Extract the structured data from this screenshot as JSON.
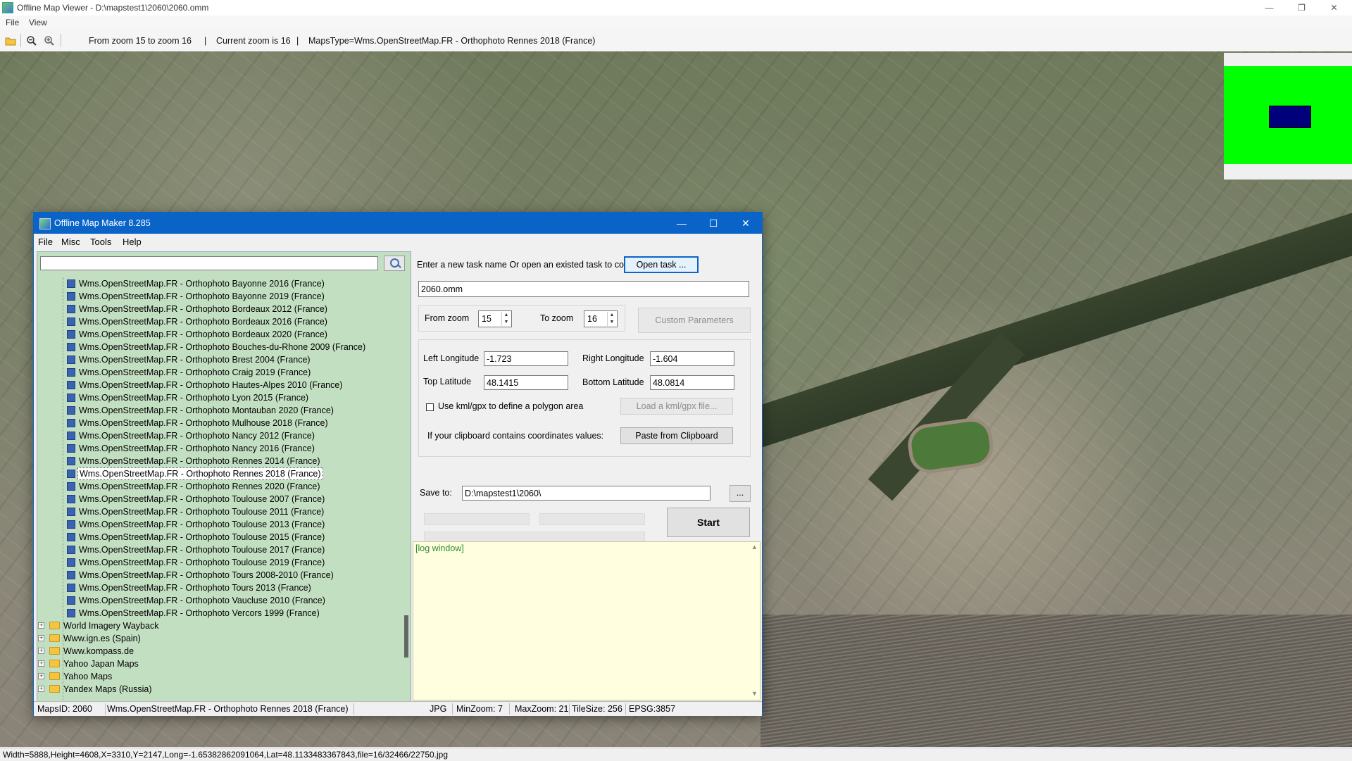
{
  "viewer": {
    "title": "Offline Map Viewer - D:\\mapstest1\\2060\\2060.omm",
    "menu": [
      "File",
      "View"
    ],
    "controls": {
      "minimize": "—",
      "maximize": "❐",
      "close": "✕"
    },
    "toolbar": {
      "zoom_range": "From zoom 15 to zoom 16",
      "sep": "|",
      "current_zoom": "Current zoom is 16",
      "maps_type": "MapsType=Wms.OpenStreetMap.FR - Orthophoto Rennes 2018 (France)"
    },
    "status": "Width=5888,Height=4608,X=3310,Y=2147,Long=-1.65382862091064,Lat=48.1133483367843,file=16/32466/22750.jpg"
  },
  "dialog": {
    "title": "Offline Map Maker 8.285",
    "controls": {
      "minimize": "—",
      "maximize": "☐",
      "close": "✕"
    },
    "menu": [
      "File",
      "Misc",
      "Tools",
      "Help"
    ],
    "search": {
      "value": "",
      "placeholder": ""
    },
    "tree": {
      "leaves": [
        "Wms.OpenStreetMap.FR - Orthophoto Bayonne 2016 (France)",
        "Wms.OpenStreetMap.FR - Orthophoto Bayonne 2019 (France)",
        "Wms.OpenStreetMap.FR - Orthophoto Bordeaux 2012 (France)",
        "Wms.OpenStreetMap.FR - Orthophoto Bordeaux 2016 (France)",
        "Wms.OpenStreetMap.FR - Orthophoto Bordeaux 2020 (France)",
        "Wms.OpenStreetMap.FR - Orthophoto Bouches-du-Rhone 2009 (France)",
        "Wms.OpenStreetMap.FR - Orthophoto Brest 2004 (France)",
        "Wms.OpenStreetMap.FR - Orthophoto Craig 2019 (France)",
        "Wms.OpenStreetMap.FR - Orthophoto Hautes-Alpes 2010 (France)",
        "Wms.OpenStreetMap.FR - Orthophoto Lyon 2015 (France)",
        "Wms.OpenStreetMap.FR - Orthophoto Montauban 2020 (France)",
        "Wms.OpenStreetMap.FR - Orthophoto Mulhouse 2018 (France)",
        "Wms.OpenStreetMap.FR - Orthophoto Nancy 2012 (France)",
        "Wms.OpenStreetMap.FR - Orthophoto Nancy 2016 (France)",
        "Wms.OpenStreetMap.FR - Orthophoto Rennes 2014 (France)",
        "Wms.OpenStreetMap.FR - Orthophoto Rennes 2018 (France)",
        "Wms.OpenStreetMap.FR - Orthophoto Rennes 2020 (France)",
        "Wms.OpenStreetMap.FR - Orthophoto Toulouse 2007 (France)",
        "Wms.OpenStreetMap.FR - Orthophoto Toulouse 2011 (France)",
        "Wms.OpenStreetMap.FR - Orthophoto Toulouse 2013 (France)",
        "Wms.OpenStreetMap.FR - Orthophoto Toulouse 2015 (France)",
        "Wms.OpenStreetMap.FR - Orthophoto Toulouse 2017 (France)",
        "Wms.OpenStreetMap.FR - Orthophoto Toulouse 2019 (France)",
        "Wms.OpenStreetMap.FR - Orthophoto Tours 2008-2010 (France)",
        "Wms.OpenStreetMap.FR - Orthophoto Tours 2013 (France)",
        "Wms.OpenStreetMap.FR - Orthophoto Vaucluse 2010 (France)",
        "Wms.OpenStreetMap.FR - Orthophoto Vercors 1999 (France)"
      ],
      "selected_leaf": "Wms.OpenStreetMap.FR - Orthophoto Rennes 2018 (France)",
      "folders": [
        "World Imagery Wayback",
        "Www.ign.es (Spain)",
        "Www.kompass.de",
        "Yahoo Japan Maps",
        "Yahoo Maps",
        "Yandex Maps (Russia)"
      ]
    },
    "task": {
      "prompt": "Enter a new task name Or open an existed task to continue:",
      "open_button": "Open task ...",
      "name_value": "2060.omm"
    },
    "zoom": {
      "from_label": "From zoom",
      "from_value": "15",
      "to_label": "To zoom",
      "to_value": "16",
      "custom_button": "Custom Parameters"
    },
    "coords": {
      "left_lon_label": "Left Longitude",
      "left_lon_value": "-1.723",
      "right_lon_label": "Right Longitude",
      "right_lon_value": "-1.604",
      "top_lat_label": "Top Latitude",
      "top_lat_value": "48.1415",
      "bottom_lat_label": "Bottom Latitude",
      "bottom_lat_value": "48.0814",
      "kml_label": "Use kml/gpx to define a polygon area",
      "kml_checked": false,
      "kml_button": "Load a kml/gpx file...",
      "clipboard_label": "If your clipboard contains coordinates values:",
      "clipboard_button": "Paste from Clipboard"
    },
    "save": {
      "label": "Save to:",
      "value": "D:\\mapstest1\\2060\\",
      "browse_button": "..."
    },
    "start_button": "Start",
    "log": "[log window]",
    "status": {
      "maps_id": "MapsID: 2060",
      "maps_name": "Wms.OpenStreetMap.FR - Orthophoto Rennes 2018 (France)",
      "format": "JPG",
      "min_zoom": "MinZoom: 7",
      "max_zoom": "MaxZoom: 21",
      "tile_size": "TileSize: 256",
      "epsg": "EPSG:3857"
    }
  },
  "colors": {
    "dialog_titlebar": "#0a64c8",
    "tree_background": "#c3dfc2",
    "log_background": "#ffffe0",
    "overview_green": "#00ff00",
    "overview_rect": "#00007a"
  }
}
